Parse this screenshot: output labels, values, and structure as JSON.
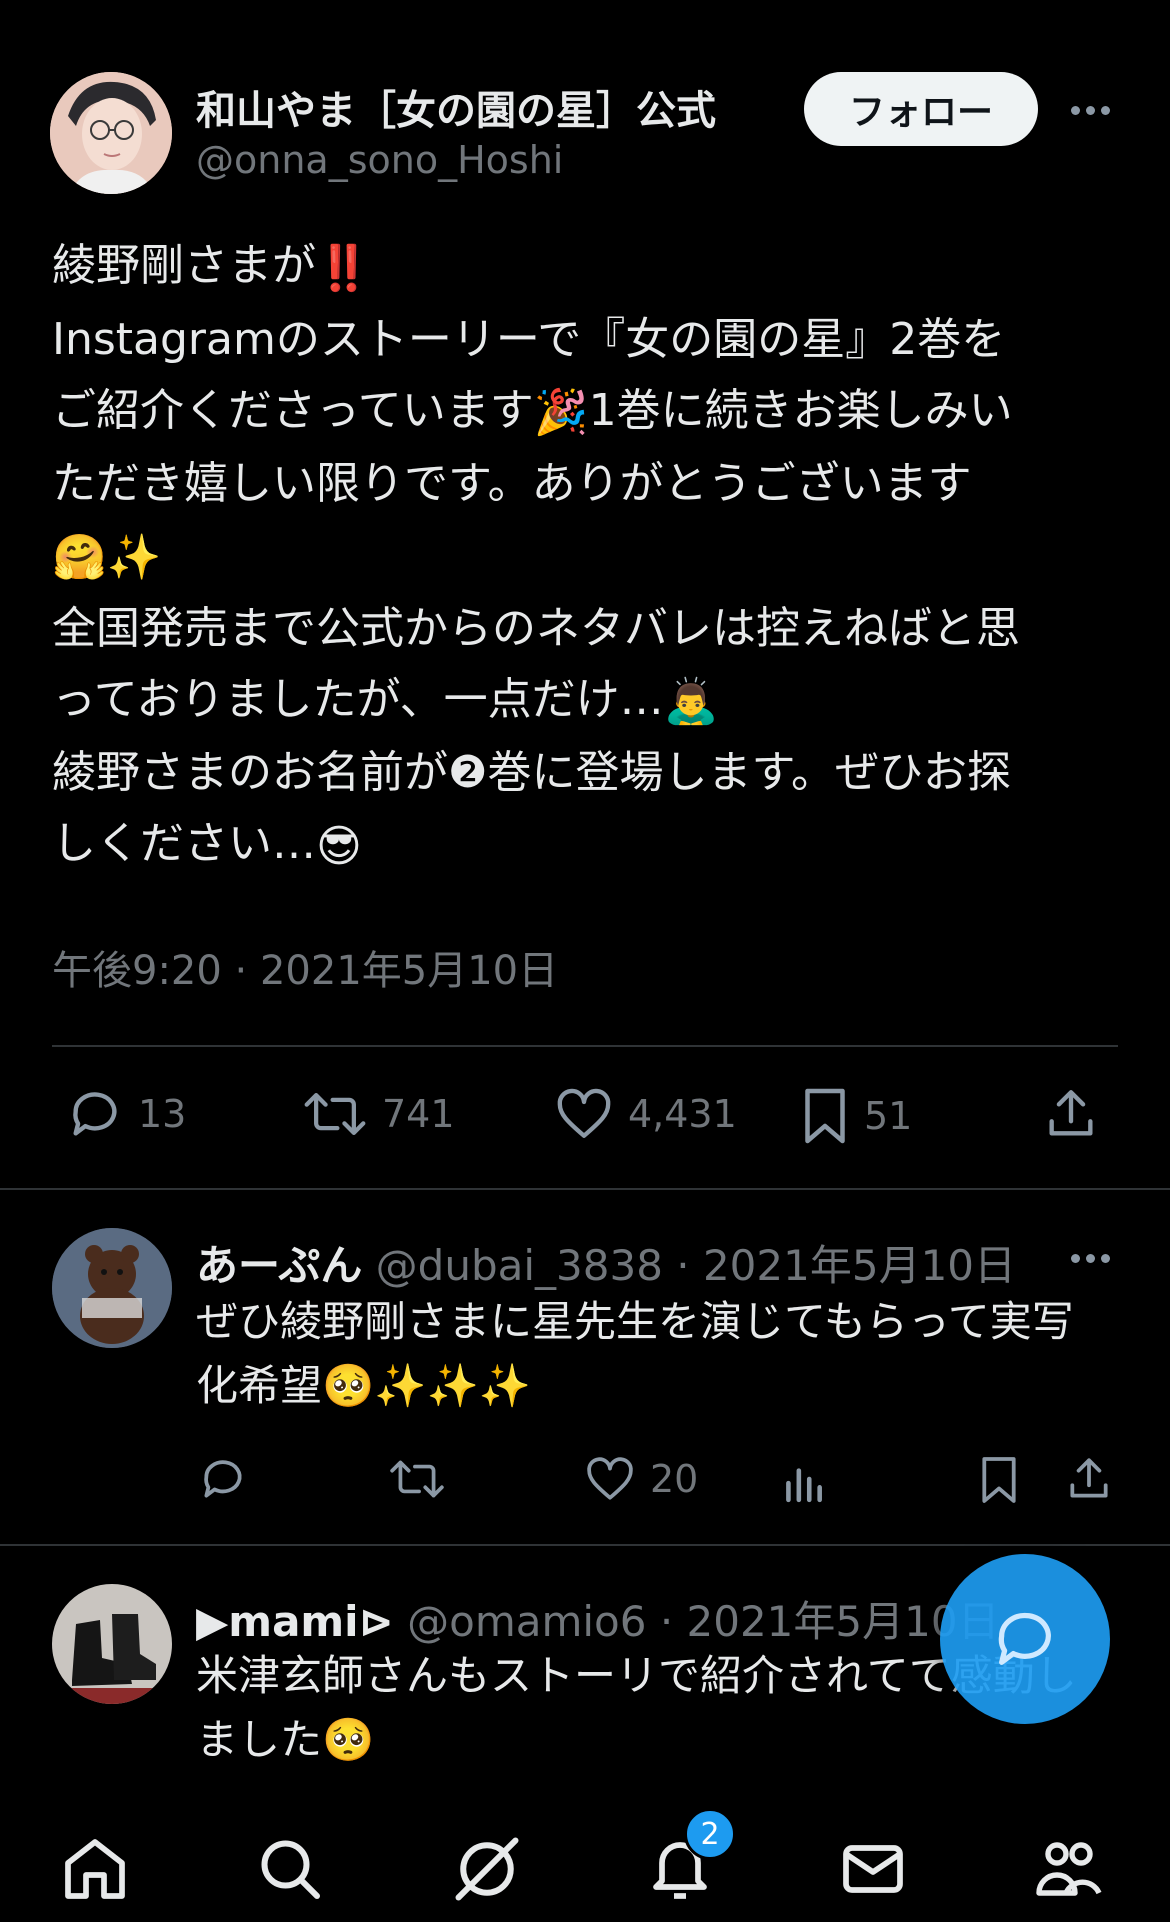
{
  "main_tweet": {
    "display_name": "和山やま［女の園の星］公式",
    "handle": "@onna_sono_Hoshi",
    "follow_label": "フォロー",
    "lines": [
      {
        "text": "綾野剛さまが",
        "emoji_after": "‼️"
      },
      {
        "text": "Instagramのストーリーで『女の園の星』2巻を"
      },
      {
        "text": "ご紹介くださっています",
        "emoji_after": "🎉",
        "text_after": "1巻に続きお楽しみい"
      },
      {
        "text": "ただき嬉しい限りです。ありがとうございます"
      },
      {
        "text": "",
        "emoji_after": "🤗✨"
      },
      {
        "text": "全国発売まで公式からのネタバレは控えねばと思"
      },
      {
        "text": "っておりましたが、一点だけ…",
        "emoji_after": "🙇‍♂️"
      },
      {
        "text": "綾野さまのお名前が❷巻に登場します。ぜひお探"
      },
      {
        "text": "しください…",
        "emoji_after": "😎"
      }
    ],
    "timestamp": "午後9:20 · 2021年5月10日",
    "stats": {
      "replies": "13",
      "retweets": "741",
      "likes": "4,431",
      "bookmarks": "51"
    }
  },
  "replies": [
    {
      "name": "あーぷん",
      "meta": " @dubai_3838 · 2021年5月10日",
      "lines": [
        "ぜひ綾野剛さまに星先生を演じてもらって実写",
        "化希望🥺✨✨✨"
      ],
      "likes": "20"
    },
    {
      "name": "▶mami⊳",
      "meta": " @omamio6 · 2021年5月10日",
      "lines": [
        "米津玄師さんもストーリで紹介されてて感動し",
        "ました🥺"
      ]
    }
  ],
  "nav": {
    "notification_badge": "2",
    "items": [
      "home-icon",
      "search-icon",
      "grok-icon",
      "notifications-icon",
      "messages-icon",
      "communities-icon"
    ]
  },
  "colors": {
    "background": "#000000",
    "text": "#e7e9ea",
    "secondary": "#71767b",
    "accent": "#1d9bf0"
  }
}
